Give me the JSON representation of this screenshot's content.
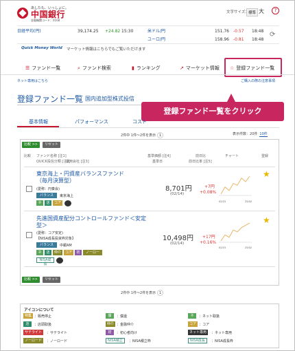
{
  "header": {
    "tagline": "あしたも、いっしょに。",
    "bank_name": "中国銀行",
    "bank_code": "金融機関コード：0168",
    "font_size_label": "文字サイズ：",
    "font_std": "標準",
    "font_big": "大",
    "help_icon": "?"
  },
  "markets": [
    {
      "name": "日経平均(円)",
      "value": "39,174.25",
      "change": "+24.82",
      "time": "15:30",
      "dir": "up"
    },
    {
      "name": "米ドル/円",
      "value": "151.76",
      "change": "-0.57",
      "time": "18:48",
      "dir": "dn"
    },
    {
      "name": "ユーロ/円",
      "value": "158.96",
      "change": "-0.81",
      "time": "18:48",
      "dir": "dn"
    }
  ],
  "quick": {
    "logo": "Quick Money World",
    "text": "マーケット情報はこちらでもご覧いただけます"
  },
  "nav": [
    {
      "label": "ファンド一覧",
      "icon": "list-icon"
    },
    {
      "label": "ファンド検索",
      "icon": "search-icon"
    },
    {
      "label": "ランキング",
      "icon": "ranking-icon"
    },
    {
      "label": "マーケット情報",
      "icon": "chart-icon"
    },
    {
      "label": "登録ファンド一覧",
      "icon": "star-outline-icon"
    }
  ],
  "links": {
    "net": "ネット専用はこちら",
    "guide": "ご購入の際の注意事項"
  },
  "page": {
    "title": "登録ファンド一覧",
    "subtitle": "国内追加型株式投信",
    "banner": "登録ファンド一覧をクリック"
  },
  "tabs": [
    "基本情報",
    "パフォーマンス",
    "コスト"
  ],
  "list": {
    "count": "2件中 1件～2件を表示",
    "page": "1",
    "per_page_label": "表示件数：",
    "per_page_20": "20件",
    "per_page_10": "10件",
    "compare": "比較 >>",
    "reset": "リセット",
    "count_bottom": "2件中 1件～2件を表示",
    "page_bottom": "1"
  },
  "columns": {
    "compare": "比較",
    "fund_name": "ファンド名称 [注1]",
    "quick_code": "QUICK投信分類 [注2]",
    "company": "運用会社 [注3]",
    "nav_price": "基準価額 [注4]",
    "nav_date": "基準日",
    "prev_ratio": "前日比",
    "prev_pct": "前日比率 [注5]",
    "chart": "チャート",
    "register": "登録"
  },
  "funds": [
    {
      "name": "東京海上・円資産バランスファンド（毎月決算型）",
      "nickname": "(愛称：円奏会)",
      "cat": "バランス",
      "company": "東京海上",
      "tags": [
        "ネ",
        "店",
        "コア"
      ],
      "price": "8,701円",
      "date": "(02/14)",
      "chg": "+7円",
      "pct": "+0.08%",
      "chart_start": "02/15",
      "chart_end": "25/02",
      "series": [
        8600,
        8640,
        8620,
        8660,
        8650,
        8690,
        8670,
        8701
      ]
    },
    {
      "name": "先進国資産配分コントロールファンド＜安定型＞",
      "nickname": "(愛称：コア安定)",
      "nisa": "【NISA成長投資枠対象】",
      "cat": "バランス",
      "company": "中銀AM",
      "tags": [
        "ネ",
        "店",
        "仲介",
        "コア",
        "初",
        "ノーロード",
        "NISA成長"
      ],
      "price": "10,498円",
      "date": "(02/14)",
      "chg": "+17円",
      "pct": "+0.16%",
      "chart_start": "02/15",
      "chart_end": "25/02",
      "series": [
        10200,
        10300,
        10260,
        10380,
        10350,
        10420,
        10460,
        10498
      ]
    }
  ],
  "legend": {
    "title": "アイコンについて",
    "items": [
      {
        "tag": "特集",
        "text": "：販売停止"
      },
      {
        "tag": "店",
        "text": "：店頭取扱"
      },
      {
        "tag": "サテライト",
        "text": "：サテライト"
      },
      {
        "tag": "ノーロード",
        "text": "：ノーロード"
      },
      {
        "tag": "償",
        "text": "：償還"
      },
      {
        "tag": "仲介",
        "text": "：金融仲介"
      },
      {
        "tag": "初",
        "text": "：初心者向け"
      },
      {
        "tag": "NISA積立",
        "text": "：NISA積立枠"
      },
      {
        "tag": "ネ",
        "text": "：ネット取扱"
      },
      {
        "tag": "コア",
        "text": "：コア"
      },
      {
        "tag": "ネット専用",
        "text": "：ネット専用"
      },
      {
        "tag": "NISA成長",
        "text": "：NISA成長枠"
      }
    ]
  }
}
